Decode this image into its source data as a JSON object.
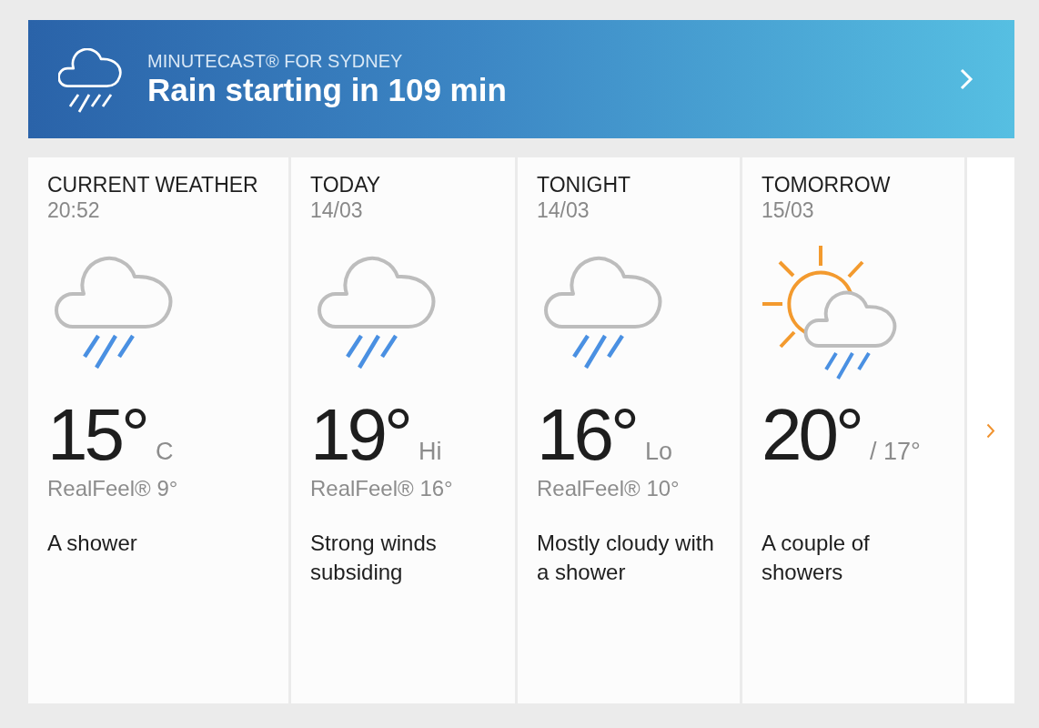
{
  "banner": {
    "label": "MINUTECAST® FOR SYDNEY",
    "headline": "Rain starting in 109 min"
  },
  "cards": [
    {
      "kind": "rain",
      "title": "CURRENT WEATHER",
      "subtitle": "20:52",
      "temperature": "15°",
      "qualifier": "C",
      "realfeel": "RealFeel® 9°",
      "description": "A shower"
    },
    {
      "kind": "rain",
      "title": "TODAY",
      "subtitle": "14/03",
      "temperature": "19°",
      "qualifier": "Hi",
      "realfeel": "RealFeel® 16°",
      "description": "Strong winds subsiding"
    },
    {
      "kind": "rain",
      "title": "TONIGHT",
      "subtitle": "14/03",
      "temperature": "16°",
      "qualifier": "Lo",
      "realfeel": "RealFeel® 10°",
      "description": "Mostly cloudy with a shower"
    },
    {
      "kind": "sunshower",
      "title": "TOMORROW",
      "subtitle": "15/03",
      "temperature": "20°",
      "qualifier": "/ 17°",
      "description": "A couple of showers"
    }
  ]
}
